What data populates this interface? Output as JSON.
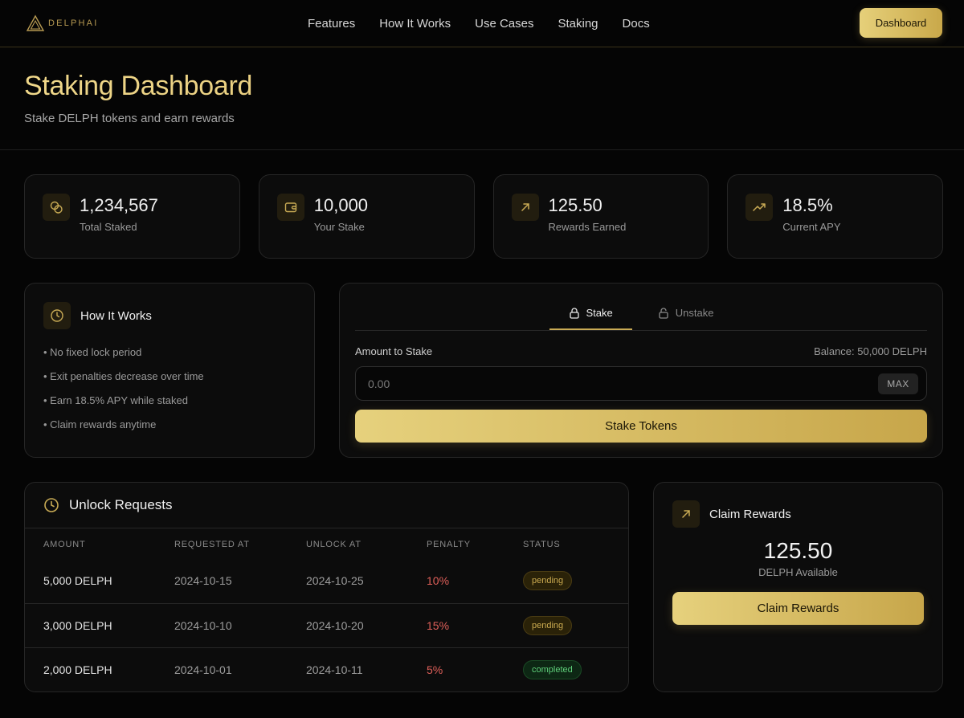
{
  "brand": {
    "name": "DELPHAI",
    "accent": "#d8b868"
  },
  "nav": {
    "links": [
      "Features",
      "How It Works",
      "Use Cases",
      "Staking",
      "Docs"
    ],
    "cta": "Dashboard"
  },
  "hero": {
    "title": "Staking Dashboard",
    "subtitle": "Stake DELPH tokens and earn rewards"
  },
  "stats": [
    {
      "icon": "coins-icon",
      "value": "1,234,567",
      "label": "Total Staked"
    },
    {
      "icon": "wallet-icon",
      "value": "10,000",
      "label": "Your Stake"
    },
    {
      "icon": "arrow-up-right-icon",
      "value": "125.50",
      "label": "Rewards Earned"
    },
    {
      "icon": "trending-up-icon",
      "value": "18.5%",
      "label": "Current APY"
    }
  ],
  "how_it_works": {
    "title": "How It Works",
    "items": [
      "• No fixed lock period",
      "• Exit penalties decrease over time",
      "• Earn 18.5% APY while staked",
      "• Claim rewards anytime"
    ]
  },
  "stake_panel": {
    "tabs": [
      {
        "label": "Stake",
        "active": true
      },
      {
        "label": "Unstake",
        "active": false
      }
    ],
    "amount_label": "Amount to Stake",
    "balance": "Balance: 50,000 DELPH",
    "input_placeholder": "0.00",
    "max_label": "MAX",
    "submit_label": "Stake Tokens"
  },
  "unlock_requests": {
    "title": "Unlock Requests",
    "columns": [
      "AMOUNT",
      "REQUESTED AT",
      "UNLOCK AT",
      "PENALTY",
      "STATUS"
    ],
    "rows": [
      {
        "amount": "5,000 DELPH",
        "requested": "2024-10-15",
        "unlock": "2024-10-25",
        "penalty": "10%",
        "status": "pending"
      },
      {
        "amount": "3,000 DELPH",
        "requested": "2024-10-10",
        "unlock": "2024-10-20",
        "penalty": "15%",
        "status": "pending"
      },
      {
        "amount": "2,000 DELPH",
        "requested": "2024-10-01",
        "unlock": "2024-10-11",
        "penalty": "5%",
        "status": "completed"
      }
    ]
  },
  "claim": {
    "title": "Claim Rewards",
    "value": "125.50",
    "sub": "DELPH Available",
    "button": "Claim Rewards"
  }
}
